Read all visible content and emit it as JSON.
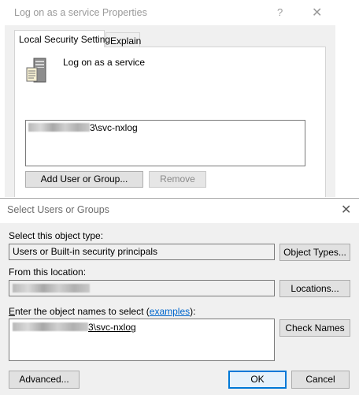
{
  "properties_window": {
    "title": "Log on as a service Properties",
    "help_glyph": "?",
    "close_glyph": "✕",
    "tabs": [
      {
        "label": "Local Security Setting",
        "active": true
      },
      {
        "label": "Explain",
        "active": false
      }
    ],
    "policy_name": "Log on as a service",
    "accounts": [
      {
        "domain_redacted": true,
        "suffix": "3\\svc-nxlog"
      }
    ],
    "add_button": "Add User or Group...",
    "remove_button": "Remove"
  },
  "select_dialog": {
    "title": "Select Users or Groups",
    "close_glyph": "✕",
    "object_type_label": "Select this object type:",
    "object_type_value": "Users or Built-in security principals",
    "object_types_button": "Object Types...",
    "location_label": "From this location:",
    "location_value_redacted": true,
    "locations_button": "Locations...",
    "names_label_prefix": "nter the object names to select (",
    "names_label_access_key": "E",
    "names_label_link": "examples",
    "names_label_suffix": "):",
    "names_value_suffix": "3\\svc-nxlog",
    "check_names_button": "Check Names",
    "advanced_button": "Advanced...",
    "ok_button": "OK",
    "cancel_button": "Cancel"
  },
  "colors": {
    "accent": "#0078d7",
    "link": "#0066cc",
    "dialog_bg": "#f0f0f0",
    "disabled_text": "#8a8a8a"
  },
  "icons": [
    "server-policy-icon",
    "help-icon",
    "close-icon"
  ]
}
